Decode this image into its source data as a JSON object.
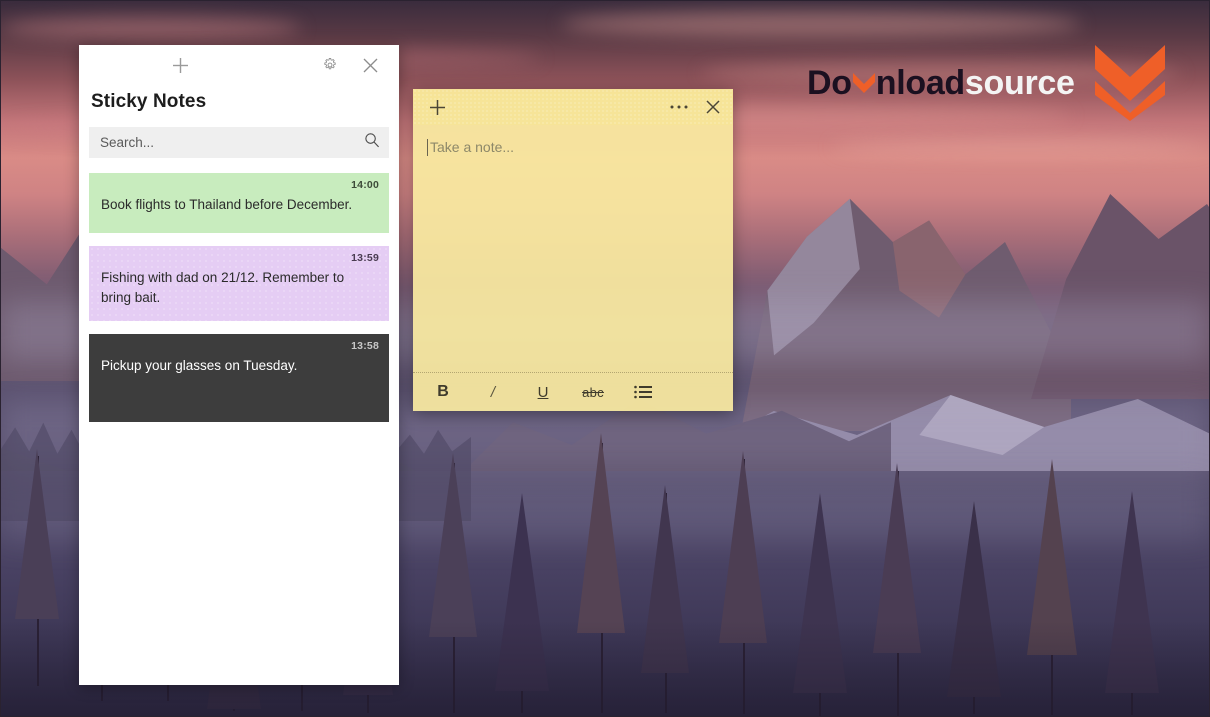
{
  "window_title": "Sticky Notes",
  "notes_panel": {
    "titlebar": {
      "add_label": "+",
      "add_name": "New note",
      "settings_name": "Settings",
      "close_name": "Close"
    },
    "title": "Sticky Notes",
    "search": {
      "value": "",
      "placeholder": "Search...",
      "icon": "search-icon"
    },
    "notes": [
      {
        "time": "14:00",
        "text": "Book flights to Thailand before December.",
        "color": "#c8ecbe",
        "theme": "green"
      },
      {
        "time": "13:59",
        "text": "Fishing with dad on 21/12. Remember to bring bait.",
        "color": "#e5cdf4",
        "theme": "purple"
      },
      {
        "time": "13:58",
        "text": "Pickup your glasses on Tuesday.",
        "color": "#3d3d3d",
        "theme": "dark"
      }
    ]
  },
  "note_window": {
    "titlebar": {
      "add_label": "+",
      "menu_label": "⋯",
      "close_label": "✕"
    },
    "placeholder": "Take a note...",
    "body_value": "",
    "background_color": "#f9eaa0",
    "toolbar": [
      {
        "id": "bold",
        "label": "B",
        "name": "bold-button"
      },
      {
        "id": "italic",
        "label": "/",
        "name": "italic-button"
      },
      {
        "id": "underline",
        "label": "U",
        "name": "underline-button"
      },
      {
        "id": "strike",
        "label": "abc",
        "name": "strikethrough-button"
      },
      {
        "id": "bullets",
        "label": "",
        "name": "bullet-list-button"
      }
    ]
  },
  "watermark": {
    "part1": "Do",
    "part2": "nload",
    "part3": "source",
    "accent_color": "#ef5f28"
  },
  "colors": {
    "accent": "#ef5f28",
    "panel_background": "#ffffff",
    "search_background": "#efefef",
    "note_yellow": "#f9eaa0",
    "sky_pink": "#d98b86",
    "valley_purple": "#554d6b"
  }
}
